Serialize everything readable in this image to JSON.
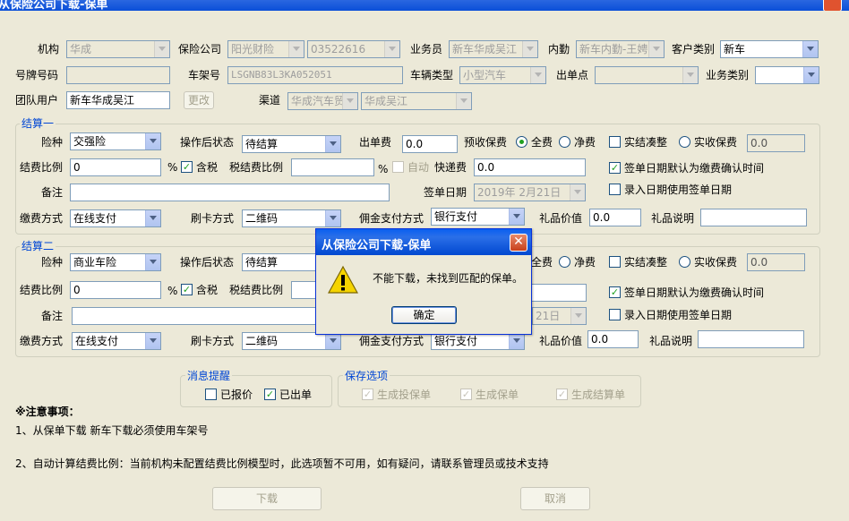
{
  "window": {
    "title": "从保险公司下载-保单"
  },
  "header": {
    "org_label": "机构",
    "org_value": "华成",
    "insurer_label": "保险公司",
    "insurer_value": "阳光财险",
    "insurer_code": "03522616",
    "salesman_label": "业务员",
    "salesman_value": "新车华成吴江",
    "internal_label": "内勤",
    "internal_value": "新车内勤-王娉",
    "customer_type_label": "客户类别",
    "customer_type_value": "新车",
    "plate_label": "号牌号码",
    "plate_value": "",
    "vin_label": "车架号",
    "vin_value": "LSGNB83L3KA052051",
    "vehicle_type_label": "车辆类型",
    "vehicle_type_value": "小型汽车",
    "issue_point_label": "出单点",
    "issue_point_value": "",
    "business_type_label": "业务类别",
    "business_type_value": "",
    "team_label": "团队用户",
    "team_value": "新车华成吴江",
    "change_button": "更改",
    "channel_label": "渠道",
    "channel_value1": "华成汽车贸",
    "channel_value2": "华成吴江"
  },
  "section1": {
    "title": "结算一",
    "risk_label": "险种",
    "risk_value": "交强险",
    "status_label": "操作后状态",
    "status_value": "待结算",
    "fee_label": "出单费",
    "fee_value": "0.0",
    "premium_label": "预收保费",
    "full_label": "全费",
    "net_label": "净费",
    "actual_label": "实结凑整",
    "actual_premium_label": "实收保费",
    "actual_premium_value": "0.0",
    "ratio_label": "结费比例",
    "ratio_value": "0",
    "pct": "%",
    "tax_included_label": "含税",
    "tax_ratio_label": "税结费比例",
    "tax_ratio_value": "",
    "pct2": "%",
    "auto_label": "自动",
    "express_label": "快递费",
    "express_value": "0.0",
    "sign_default_label": "签单日期默认为缴费确认时间",
    "remark_label": "备注",
    "remark_value": "",
    "sign_date_label": "签单日期",
    "sign_date_value": "2019年 2月21日",
    "entry_date_label": "录入日期使用签单日期",
    "pay_label": "缴费方式",
    "pay_value": "在线支付",
    "card_label": "刷卡方式",
    "card_value": "二维码",
    "commission_label": "佣金支付方式",
    "commission_value": "银行支付",
    "gift_value_label": "礼品价值",
    "gift_value_value": "0.0",
    "gift_desc_label": "礼品说明",
    "gift_desc_value": ""
  },
  "section2": {
    "title": "结算二",
    "risk_label": "险种",
    "risk_value": "商业车险",
    "status_label": "操作后状态",
    "status_value": "待结算",
    "full_label": "全费",
    "net_label": "净费",
    "actual_label": "实结凑整",
    "actual_premium_label": "实收保费",
    "actual_premium_value": "0.0",
    "ratio_label": "结费比例",
    "ratio_value": "0",
    "pct": "%",
    "tax_included_label": "含税",
    "tax_ratio_label": "税结费比例",
    "sign_default_label": "签单日期默认为缴费确认时间",
    "remark_label": "备注",
    "sign_date_value_partial": "21日",
    "entry_date_label": "录入日期使用签单日期",
    "pay_label": "缴费方式",
    "pay_value": "在线支付",
    "card_label": "刷卡方式",
    "card_value": "二维码",
    "commission_label": "佣金支付方式",
    "commission_value": "银行支付",
    "gift_value_label": "礼品价值",
    "gift_value_value": "0.0",
    "gift_desc_label": "礼品说明",
    "gift_desc_value": ""
  },
  "message_group": {
    "title": "消息提醒",
    "quoted_label": "已报价",
    "issued_label": "已出单"
  },
  "save_group": {
    "title": "保存选项",
    "gen_quote": "生成投保单",
    "gen_policy": "生成保单",
    "gen_settlement": "生成结算单"
  },
  "notes": {
    "title": "※注意事项：",
    "line1": "1、从保单下载 新车下载必须使用车架号",
    "line2": "2、自动计算结费比例：当前机构未配置结费比例模型时，此选项暂不可用，如有疑问，请联系管理员或技术支持"
  },
  "buttons": {
    "download": "下载",
    "cancel": "取消"
  },
  "dialog": {
    "title": "从保险公司下载-保单",
    "message": "不能下载，未找到匹配的保单。",
    "ok": "确定"
  }
}
